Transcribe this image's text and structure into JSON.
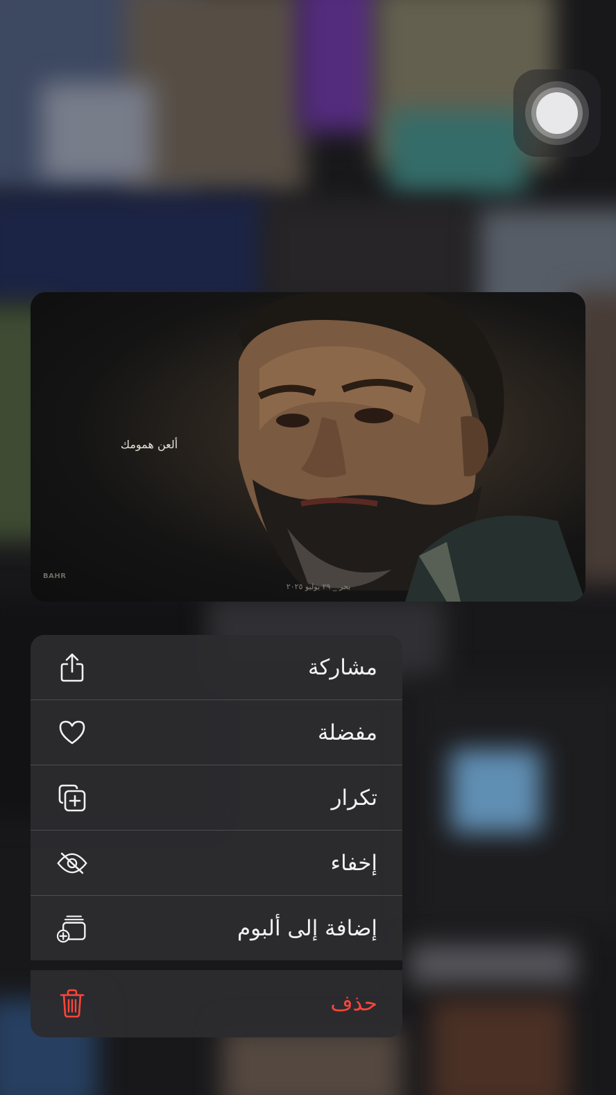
{
  "preview": {
    "caption": "ألعن همومك",
    "stamp": "بحر _ ٢٩ يوليو ٢٠٢٥",
    "logo": "BAHR"
  },
  "menu": {
    "items": [
      {
        "label": "مشاركة",
        "icon": "share-icon"
      },
      {
        "label": "مفضلة",
        "icon": "heart-icon"
      },
      {
        "label": "تكرار",
        "icon": "duplicate-icon"
      },
      {
        "label": "إخفاء",
        "icon": "eye-slash-icon"
      },
      {
        "label": "إضافة إلى ألبوم",
        "icon": "add-to-album-icon"
      }
    ],
    "delete": {
      "label": "حذف",
      "icon": "trash-icon",
      "color": "#ff453a"
    }
  },
  "colors": {
    "menu_background": "#2c2c2f",
    "menu_text": "#f2f2f5",
    "destructive": "#ff453a"
  }
}
